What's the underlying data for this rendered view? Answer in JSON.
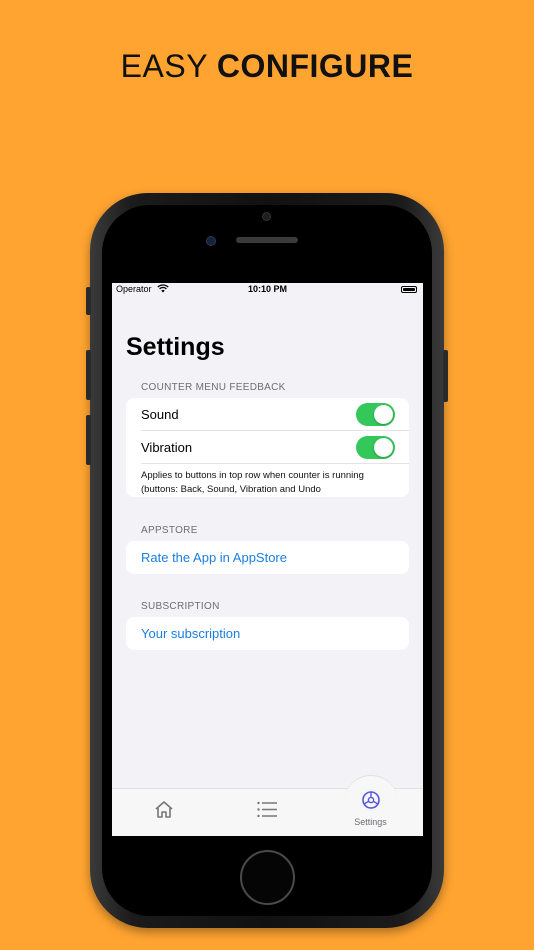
{
  "headline": {
    "light": "EASY ",
    "bold": "CONFIGURE"
  },
  "status": {
    "carrier": "Operator",
    "time": "10:10 PM",
    "wifi_icon": "wifi-icon",
    "battery_icon": "battery-icon"
  },
  "page_title": "Settings",
  "sections": {
    "feedback": {
      "header": "COUNTER MENU FEEDBACK",
      "rows": [
        {
          "label": "Sound",
          "on": true
        },
        {
          "label": "Vibration",
          "on": true
        }
      ],
      "note": "Applies to buttons in top row when  counter is running (buttons: Back, Sound, Vibration and Undo"
    },
    "appstore": {
      "header": "APPSTORE",
      "link": "Rate the App in AppStore"
    },
    "subscription": {
      "header": "SUBSCRIPTION",
      "link": "Your subscription"
    }
  },
  "tabbar": {
    "tabs": [
      {
        "icon": "home-icon",
        "label": ""
      },
      {
        "icon": "list-icon",
        "label": ""
      },
      {
        "icon": "settings-icon",
        "label": "Settings",
        "active": true
      }
    ]
  },
  "colors": {
    "background": "#FFA431",
    "toggle_on": "#34C759",
    "link": "#1a7fe0",
    "settings_icon": "#5856D6"
  }
}
